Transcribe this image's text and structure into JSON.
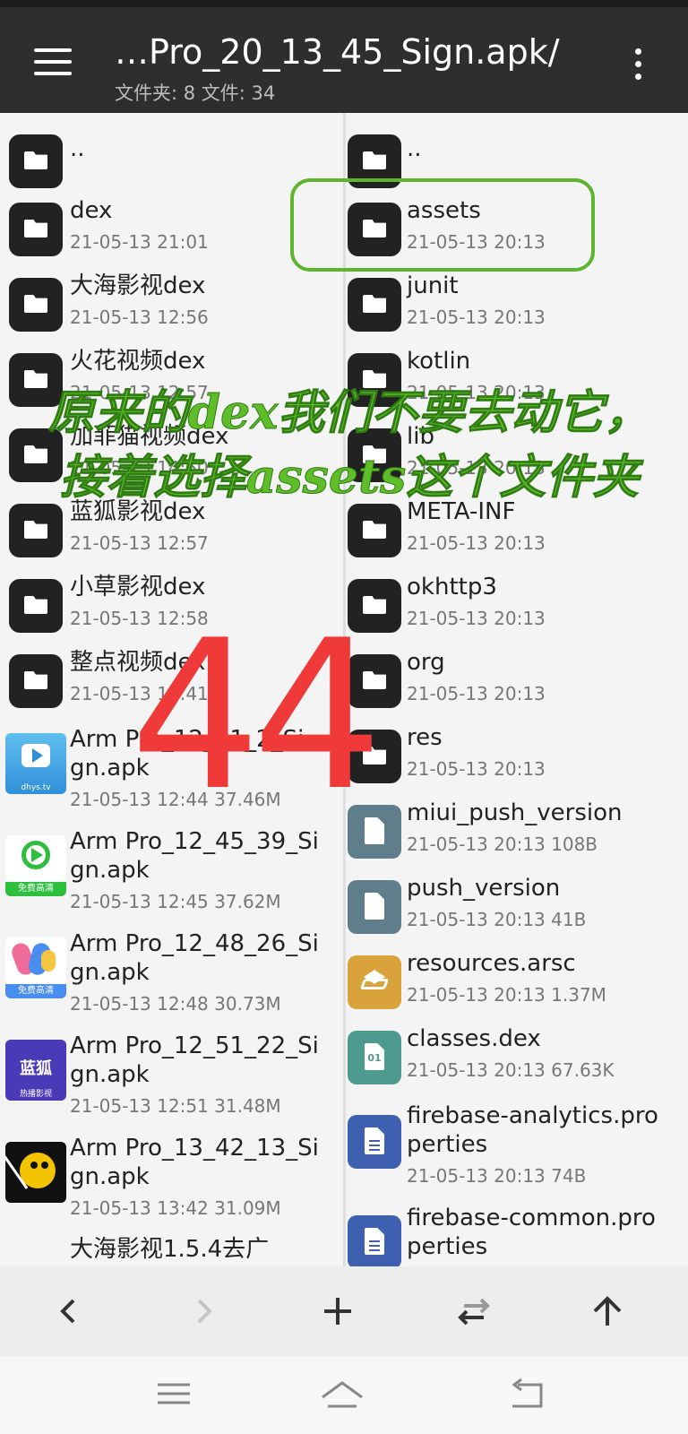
{
  "header": {
    "title": "…Pro_20_13_45_Sign.apk/",
    "subtitle": "文件夹: 8  文件: 34",
    "menu_icon": "hamburger-icon",
    "more_icon": "more-vert-icon"
  },
  "left_pane": {
    "items": [
      {
        "name": "..",
        "meta": "",
        "icon": "folder-icon"
      },
      {
        "name": "dex",
        "meta": "21-05-13 21:01",
        "icon": "folder-icon"
      },
      {
        "name": "大海影视dex",
        "meta": "21-05-13 12:56",
        "icon": "folder-icon"
      },
      {
        "name": "火花视频dex",
        "meta": "21-05-13 12:57",
        "icon": "folder-icon"
      },
      {
        "name": "加菲猫视频dex",
        "meta": "21-05-13 14:50",
        "icon": "folder-icon"
      },
      {
        "name": "蓝狐影视dex",
        "meta": "21-05-13 12:57",
        "icon": "folder-icon"
      },
      {
        "name": "小草影视dex",
        "meta": "21-05-13 12:58",
        "icon": "folder-icon"
      },
      {
        "name": "整点视频dex",
        "meta": "21-05-13 13:41",
        "icon": "folder-icon"
      },
      {
        "name_line1": "Arm Pro_12_41_2_Si",
        "name_line2": "gn.apk",
        "meta": "21-05-13 12:44  37.46M",
        "icon": "app-icon-dhys",
        "icon_label": "dhys.tv"
      },
      {
        "name_line1": "Arm Pro_12_45_39_Si",
        "name_line2": "gn.apk",
        "meta": "21-05-13 12:45  37.62M",
        "icon": "app-icon-play",
        "icon_label": "免费高清"
      },
      {
        "name_line1": "Arm Pro_12_48_26_Si",
        "name_line2": "gn.apk",
        "meta": "21-05-13 12:48  30.73M",
        "icon": "app-icon-colorful",
        "icon_label": "免费高清"
      },
      {
        "name_line1": "Arm Pro_12_51_22_Si",
        "name_line2": "gn.apk",
        "meta": "21-05-13 12:51  31.48M",
        "icon": "app-icon-lanhu",
        "icon_label": "蓝狐",
        "icon_sub": "热播影视"
      },
      {
        "name_line1": "Arm Pro_13_42_13_Si",
        "name_line2": "gn.apk",
        "meta": "21-05-13 13:42  31.09M",
        "icon": "app-icon-clock"
      },
      {
        "name": "大海影视1.5.4去广",
        "meta": "",
        "icon": "none"
      }
    ]
  },
  "right_pane": {
    "items": [
      {
        "name": "..",
        "meta": "",
        "icon": "folder-icon"
      },
      {
        "name": "assets",
        "meta": "21-05-13 20:13",
        "icon": "folder-icon"
      },
      {
        "name": "junit",
        "meta": "21-05-13 20:13",
        "icon": "folder-icon"
      },
      {
        "name": "kotlin",
        "meta": "21-05-13 20:13",
        "icon": "folder-icon"
      },
      {
        "name": "lib",
        "meta": "21-05-13 20:13",
        "icon": "folder-icon"
      },
      {
        "name": "META-INF",
        "meta": "21-05-13 20:13",
        "icon": "folder-icon"
      },
      {
        "name": "okhttp3",
        "meta": "21-05-13 20:13",
        "icon": "folder-icon"
      },
      {
        "name": "org",
        "meta": "21-05-13 20:13",
        "icon": "folder-icon"
      },
      {
        "name": "res",
        "meta": "21-05-13 20:13",
        "icon": "folder-icon"
      },
      {
        "name": "miui_push_version",
        "meta": "21-05-13 20:13  108B",
        "icon": "file-icon",
        "color": "#607d8b"
      },
      {
        "name": "push_version",
        "meta": "21-05-13 20:13  41B",
        "icon": "file-icon",
        "color": "#607d8b"
      },
      {
        "name": "resources.arsc",
        "meta": "21-05-13 20:13  1.37M",
        "icon": "layers-icon",
        "color": "#d9a23a"
      },
      {
        "name": "classes.dex",
        "meta": "21-05-13 20:13  67.63K",
        "icon": "dex-file-icon",
        "color": "#4e9a8e",
        "glyph": "01"
      },
      {
        "name_line1": "firebase-analytics.pro",
        "name_line2": "perties",
        "meta": "21-05-13 20:13  74B",
        "icon": "doc-icon",
        "color": "#3f5fb0"
      },
      {
        "name_line1": "firebase-common.pro",
        "name_line2": "perties",
        "meta": "",
        "icon": "doc-icon",
        "color": "#3f5fb0"
      }
    ]
  },
  "toolbar": {
    "back_icon": "chevron-left-icon",
    "forward_icon": "chevron-right-icon",
    "add_icon": "plus-icon",
    "swap_icon": "swap-icon",
    "up_icon": "arrow-up-icon"
  },
  "annotation": {
    "text": "原来的dex我们不要去动它，接着选择assets这个文件夹",
    "number": "44",
    "highlight_target": "assets"
  },
  "colors": {
    "appbar": "#2e2e2e",
    "highlight": "#5db52e",
    "annotation_text": "#5fbd2a",
    "number": "#f03a3a"
  }
}
